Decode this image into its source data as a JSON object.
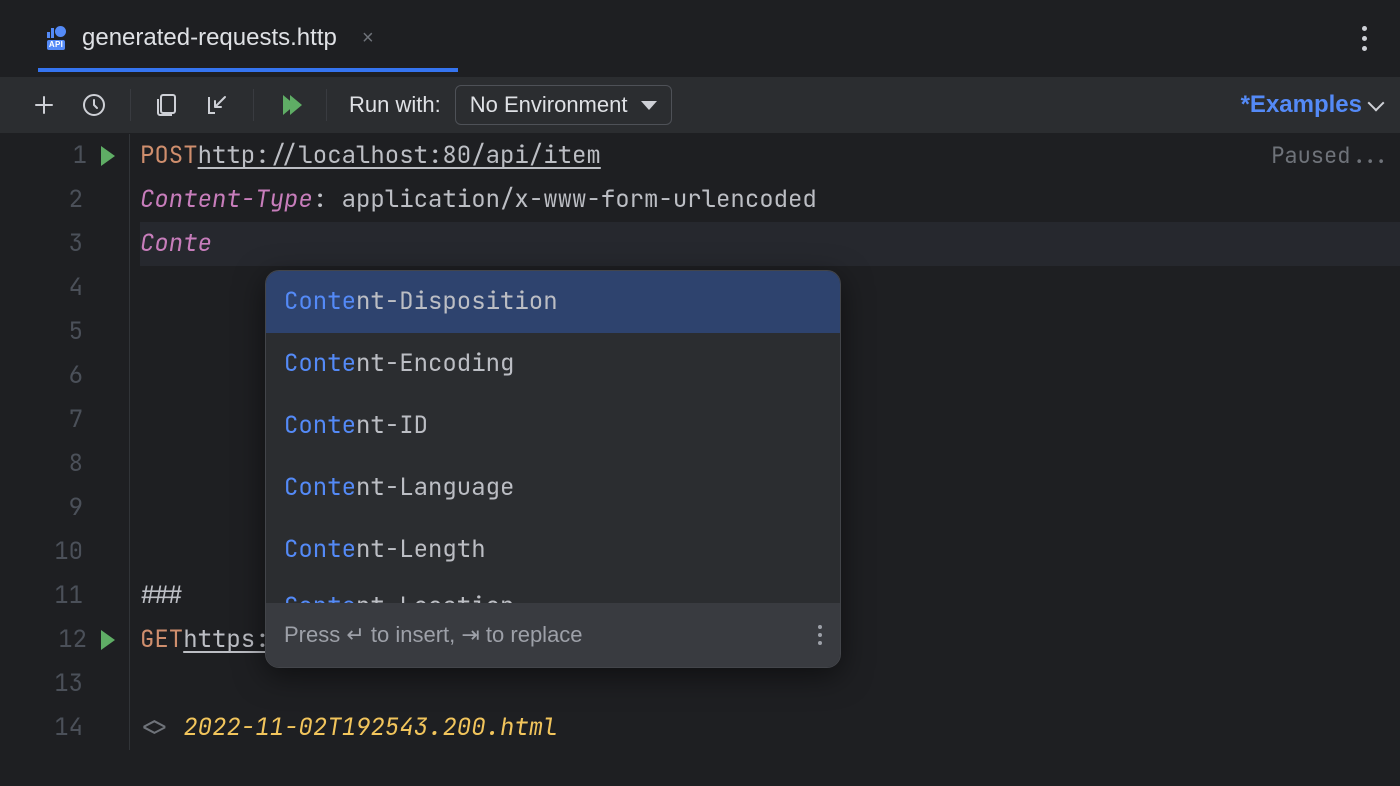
{
  "tab": {
    "icon": "api-icon",
    "title": "generated-requests.http"
  },
  "toolbar": {
    "run_with_label": "Run with:",
    "env_selected": "No Environment",
    "examples_label": "*Examples"
  },
  "status": {
    "paused": "Paused..."
  },
  "editor": {
    "lines": [
      {
        "n": 1,
        "play": true,
        "method": "POST",
        "url": "http://localhost:80/api/item"
      },
      {
        "n": 2,
        "header_key": "Content-Type",
        "header_value": "application/x-www-form-urlencoded"
      },
      {
        "n": 3,
        "typed": "Conte",
        "highlight": true
      },
      {
        "n": 4
      },
      {
        "n": 5
      },
      {
        "n": 6
      },
      {
        "n": 7
      },
      {
        "n": 8
      },
      {
        "n": 9
      },
      {
        "n": 10
      },
      {
        "n": 11,
        "text": "###"
      },
      {
        "n": 12,
        "play": true,
        "method": "GET",
        "url": "https://www.jetbrains.com/"
      },
      {
        "n": 13
      },
      {
        "n": 14,
        "response_prefix": "<> ",
        "response_file": "2022-11-02T192543.200.html"
      }
    ]
  },
  "completion": {
    "match_prefix": "Conte",
    "items": [
      {
        "suffix": "nt-Disposition",
        "selected": true
      },
      {
        "suffix": "nt-Encoding"
      },
      {
        "suffix": "nt-ID"
      },
      {
        "suffix": "nt-Language"
      },
      {
        "suffix": "nt-Length"
      },
      {
        "suffix": "nt-Location",
        "cut": true
      }
    ],
    "hint": "Press ↵ to insert, ⇥ to replace"
  }
}
